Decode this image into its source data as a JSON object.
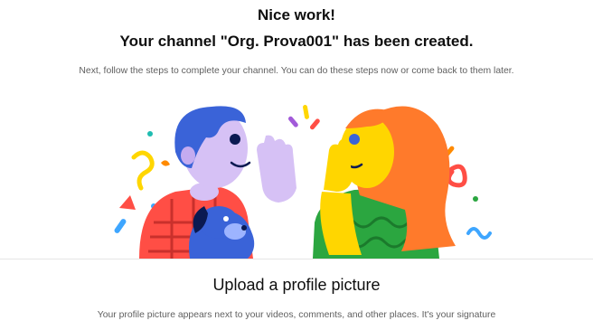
{
  "header": {
    "line1": "Nice work!",
    "line2": "Your channel \"Org. Prova001\" has been created.",
    "subtitle": "Next, follow the steps to complete your channel. You can do these steps now or come back to them later."
  },
  "step": {
    "title": "Upload a profile picture",
    "description": "Your profile picture appears next to your videos, comments, and other places. It's your signature"
  },
  "illustration": {
    "name": "high-five-celebration-illustration"
  },
  "colors": {
    "text_primary": "#0f0f0f",
    "text_secondary": "#606060",
    "divider": "#e5e5e5",
    "confetti_blue": "#3ea6ff",
    "confetti_yellow": "#ffd600",
    "confetti_red": "#ff4e45",
    "confetti_green": "#2ba640"
  }
}
